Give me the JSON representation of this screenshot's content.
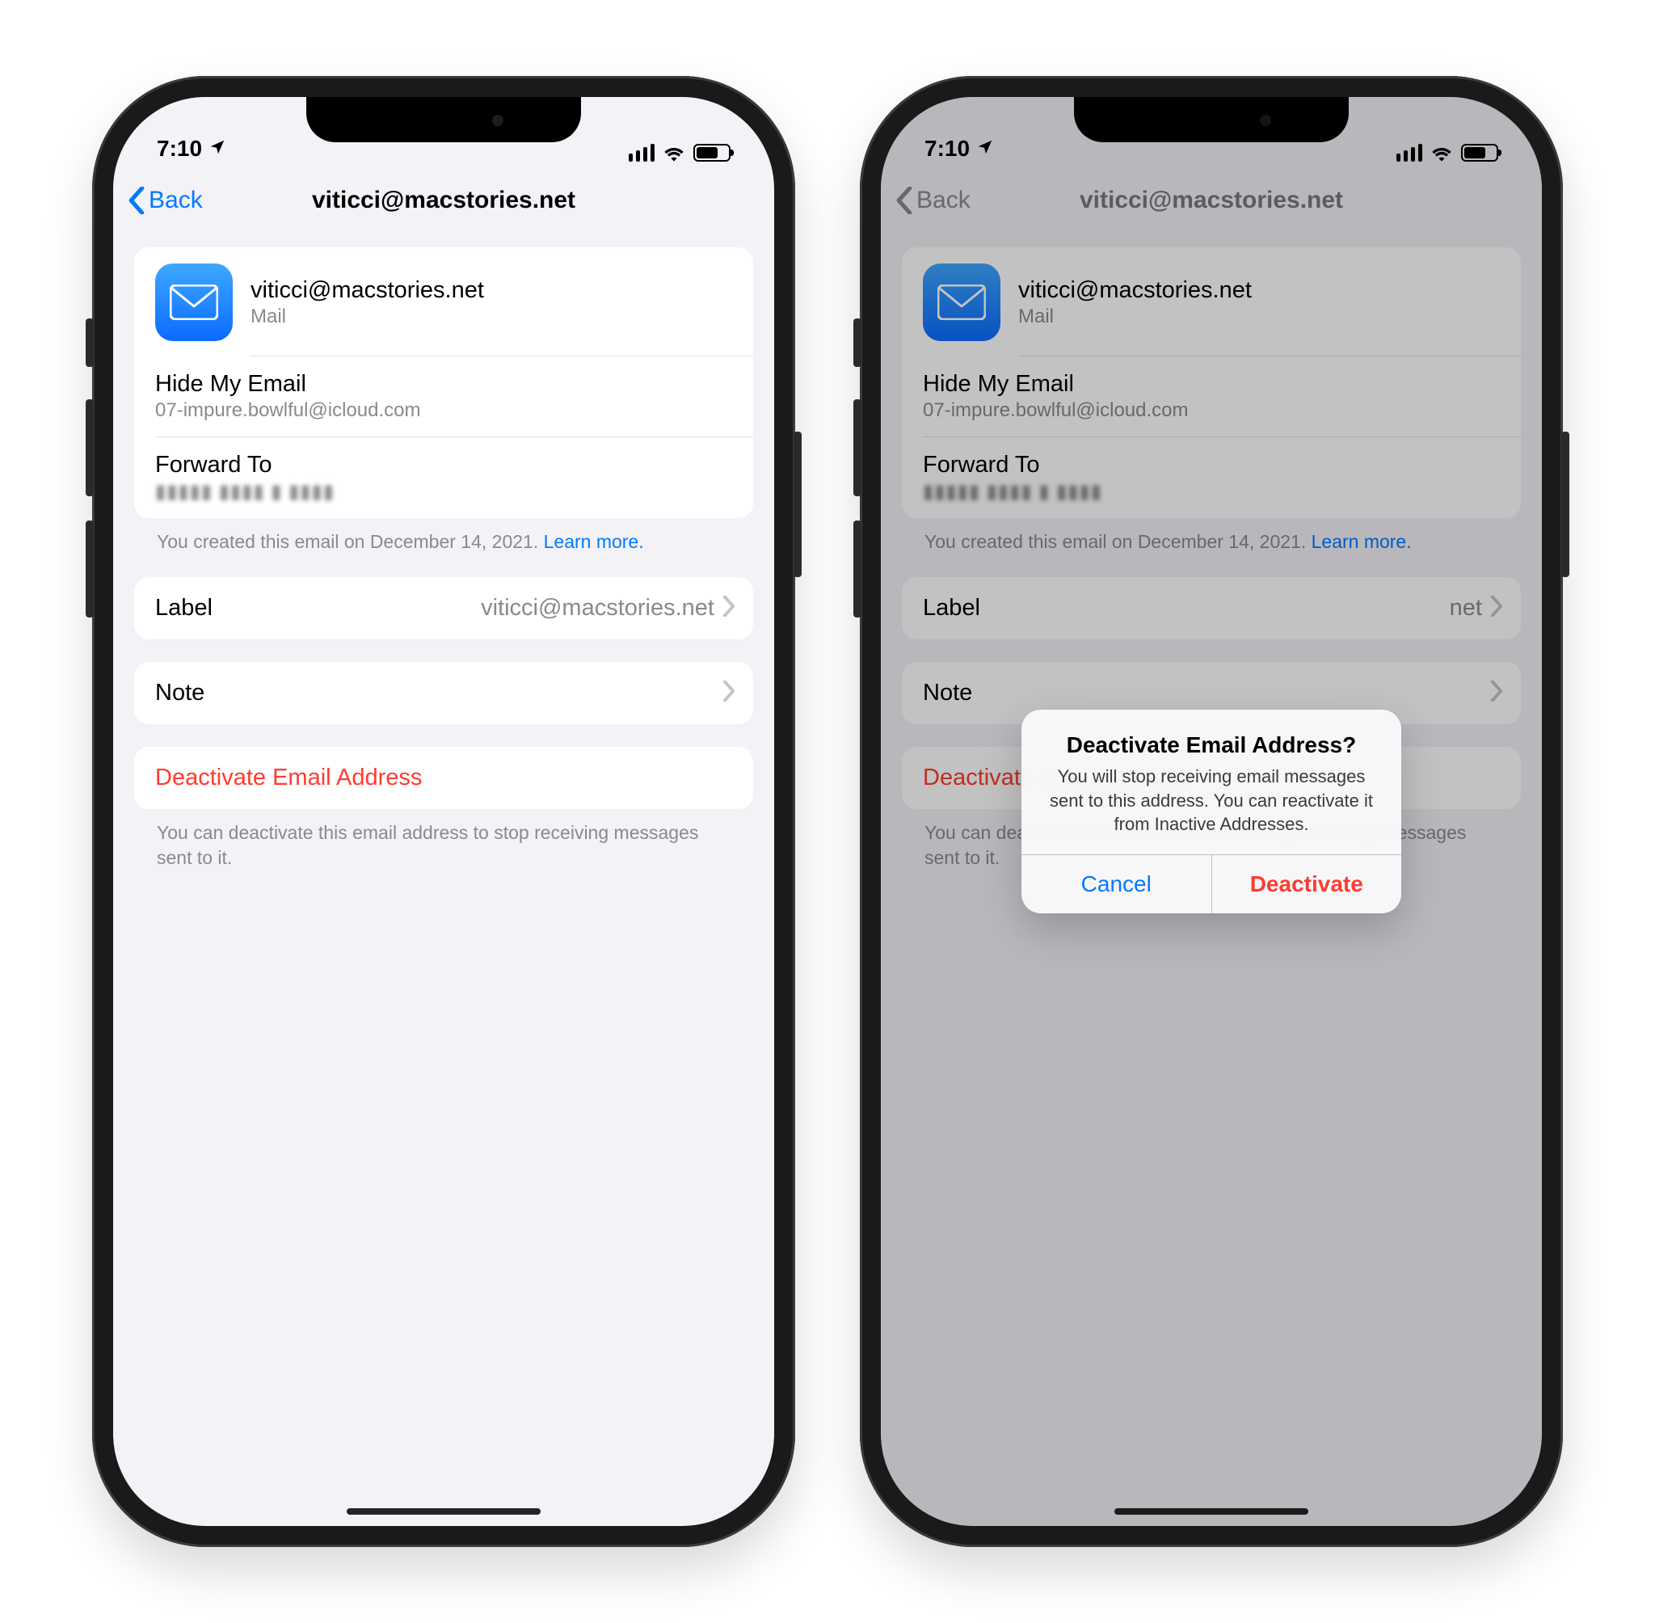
{
  "statusbar": {
    "time": "7:10"
  },
  "navbar": {
    "back_label": "Back",
    "title": "viticci@macstories.net"
  },
  "header": {
    "app_title": "viticci@macstories.net",
    "app_subtitle": "Mail"
  },
  "hide_my_email": {
    "label": "Hide My Email",
    "value": "07-impure.bowlful@icloud.com"
  },
  "forward_to": {
    "label": "Forward To",
    "value_obscured": "▮▮▮▮▮ ▮▮▮▮ ▮ ▮▮▮▮"
  },
  "created_footer": {
    "text": "You created this email on December 14, 2021. ",
    "learn_more": "Learn more."
  },
  "label_row": {
    "label": "Label",
    "value": "viticci@macstories.net"
  },
  "note_row": {
    "label": "Note"
  },
  "deactivate": {
    "button": "Deactivate Email Address",
    "footer": "You can deactivate this email address to stop receiving messages sent to it."
  },
  "alert": {
    "title": "Deactivate Email Address?",
    "message": "You will stop receiving email messages sent to this address. You can reactivate it from Inactive Addresses.",
    "cancel": "Cancel",
    "confirm": "Deactivate"
  }
}
